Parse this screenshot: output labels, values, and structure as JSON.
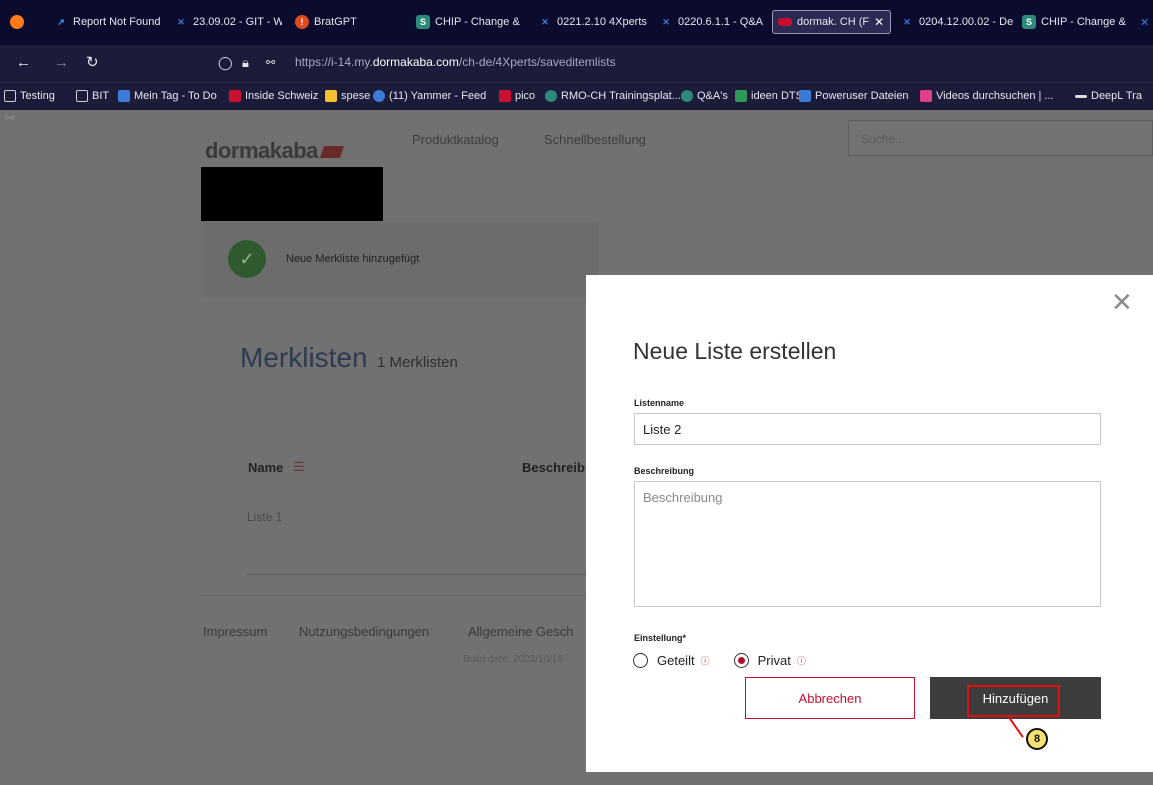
{
  "browser": {
    "tabs": [
      {
        "label": "Report Not Found",
        "color": "#3aa0ff"
      },
      {
        "label": "23.09.02 - GIT - W",
        "color": "#3a7bd5"
      },
      {
        "label": "BratGPT",
        "color": "#e04a1a"
      },
      {
        "label": "CHIP - Change &",
        "color": "#2b8a7a"
      },
      {
        "label": "0221.2.10 4Xperts",
        "color": "#3a7bd5"
      },
      {
        "label": "0220.6.1.1 - Q&A",
        "color": "#3a7bd5"
      },
      {
        "label": "dormak. CH (F",
        "color": "#c8102e"
      },
      {
        "label": "0204.12.00.02 - De",
        "color": "#3a7bd5"
      },
      {
        "label": "CHIP - Change &",
        "color": "#2b8a7a"
      }
    ],
    "active_tab_index": 6,
    "url_prefix": "https://i-14.my.",
    "url_domain": "dormakaba.com",
    "url_path": "/ch-de/4Xperts/saveditemlists",
    "bookmarks": [
      "Testing",
      "BIT",
      "Mein Tag - To Do",
      "Inside Schweiz",
      "spese",
      "(11) Yammer - Feed",
      "pico",
      "RMO-CH Trainingsplat...",
      "Q&A's",
      "ideen DTS",
      "Poweruser Dateien",
      "Videos durchsuchen | ...",
      "DeepL Tra"
    ]
  },
  "site": {
    "logo": "dormakaba",
    "nav": [
      "Produktkatalog",
      "Schnellbestellung"
    ],
    "search_placeholder": "Suche...",
    "notice": "Neue Merkliste hinzugefügt",
    "list_title": "Merklisten",
    "list_count": "1 Merklisten",
    "columns": {
      "name": "Name",
      "description": "Beschreib"
    },
    "rows": [
      "Liste 1"
    ],
    "footer_links": [
      "Impressum",
      "Nutzungsbedingungen",
      "Allgemeine Gesch"
    ],
    "build_date": "Build date: 2023/10/16"
  },
  "modal": {
    "title": "Neue Liste erstellen",
    "name_label": "Listenname",
    "name_value": "Liste 2",
    "desc_label": "Beschreibung",
    "desc_placeholder": "Beschreibung",
    "setting_label": "Einstellung*",
    "options": [
      {
        "label": "Geteilt",
        "selected": false
      },
      {
        "label": "Privat",
        "selected": true
      }
    ],
    "cancel_label": "Abbrechen",
    "add_label": "Hinzufügen"
  },
  "annotation": {
    "step": "8"
  },
  "colors": {
    "brand_red": "#c8102e",
    "dark_button": "#3d3d3d"
  }
}
